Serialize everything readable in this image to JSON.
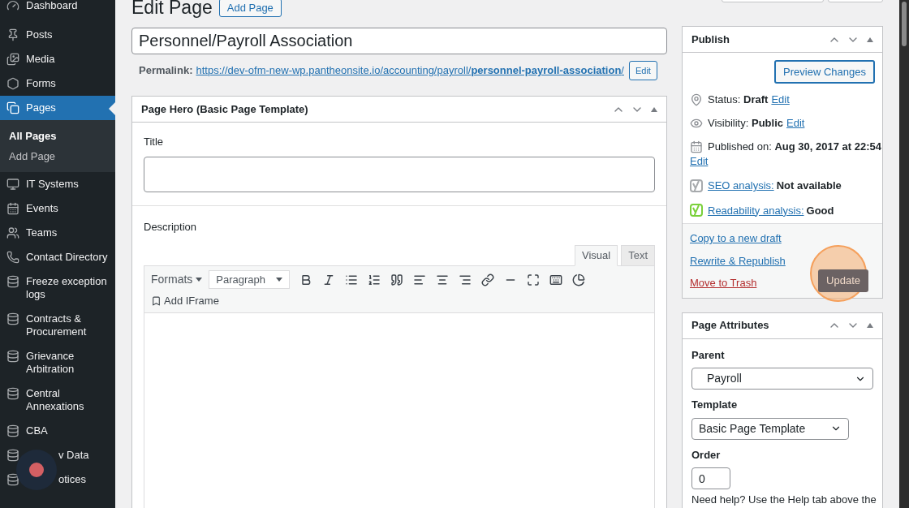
{
  "sidebar": {
    "items": [
      {
        "label": "Dashboard",
        "selected": false
      },
      {
        "label": "Posts",
        "selected": false
      },
      {
        "label": "Media",
        "selected": false
      },
      {
        "label": "Forms",
        "selected": false
      },
      {
        "label": "Pages",
        "selected": true,
        "children": [
          {
            "label": "All Pages",
            "selected": true
          },
          {
            "label": "Add Page",
            "selected": false
          }
        ]
      },
      {
        "label": "IT Systems",
        "selected": false
      },
      {
        "label": "Events",
        "selected": false
      },
      {
        "label": "Teams",
        "selected": false
      },
      {
        "label": "Contact Directory",
        "selected": false
      },
      {
        "label": "Freeze exception logs",
        "selected": false
      },
      {
        "label": "Contracts & Procurement",
        "selected": false
      },
      {
        "label": "Grievance Arbitration",
        "selected": false
      },
      {
        "label": "Central Annexations",
        "selected": false
      },
      {
        "label": "CBA",
        "selected": false
      },
      {
        "label": "v Data",
        "selected": false,
        "kind": "covered"
      },
      {
        "label": "otices",
        "selected": false,
        "kind": "covered"
      }
    ]
  },
  "header": {
    "title": "Edit Page",
    "add_button": "Add Page"
  },
  "post_title": {
    "value": "Personnel/Payroll Association"
  },
  "permalink": {
    "label": "Permalink:",
    "url": "https://dev-ofm-new-wp.pantheonsite.io/accounting/payroll/**personnel-payroll-association**/",
    "edit": "Edit"
  },
  "page_hero": {
    "title": "Page Hero (Basic Page Template)",
    "title_label": "Title",
    "description_label": "Description",
    "editor_tabs": [
      {
        "label": "Visual",
        "selected": true
      },
      {
        "label": "Text",
        "selected": false
      }
    ],
    "formats": "Formats",
    "paragraph": "Paragraph",
    "add_iframe": "Add IFrame"
  },
  "publish": {
    "title": "Publish",
    "preview": "Preview Changes",
    "rows": [
      {
        "kind": "status",
        "label": "Status:",
        "value": "Draft",
        "link": "Edit"
      },
      {
        "kind": "visibility",
        "label": "Visibility:",
        "value": "Public",
        "link": "Edit"
      },
      {
        "kind": "date",
        "label": "Published on:",
        "value": "Aug 30, 2017 at 22:54",
        "link": "Edit"
      }
    ],
    "analyses": [
      {
        "link": "SEO analysis:",
        "value": "Not available",
        "color": "#a7aaad"
      },
      {
        "link": "Readability analysis:",
        "value": "Good",
        "color": "#7ad03a"
      }
    ],
    "actions": [
      {
        "label": "Copy to a new draft",
        "kind": "link"
      },
      {
        "label": "Rewrite & Republish",
        "kind": "link"
      },
      {
        "label": "Move to Trash",
        "kind": "danger"
      }
    ],
    "update": "Update"
  },
  "page_attributes": {
    "title": "Page Attributes",
    "parent_label": "Parent",
    "parent": "Payroll",
    "template_label": "Template",
    "template": "Basic Page Template",
    "order_label": "Order",
    "order": "0",
    "help": "Need help? Use the Help tab above the"
  }
}
